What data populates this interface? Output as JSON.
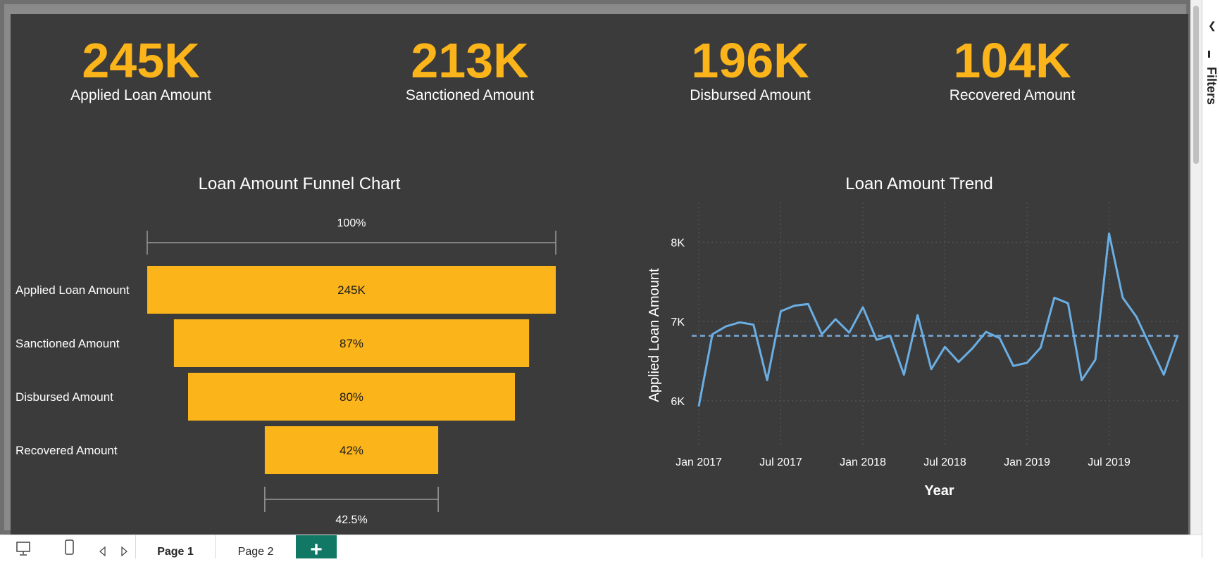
{
  "kpis": [
    {
      "value": "245K",
      "label": "Applied Loan Amount"
    },
    {
      "value": "213K",
      "label": "Sanctioned Amount"
    },
    {
      "value": "196K",
      "label": "Disbursed Amount"
    },
    {
      "value": "104K",
      "label": "Recovered Amount"
    }
  ],
  "colors": {
    "accent": "#fbb41a",
    "background": "#3b3b3b",
    "line": "#6aaee3",
    "add_tab": "#117865"
  },
  "funnel": {
    "title": "Loan Amount Funnel Chart",
    "top_label": "100%",
    "bottom_label": "42.5%"
  },
  "trend": {
    "title": "Loan Amount Trend"
  },
  "chart_data": [
    {
      "type": "bar",
      "subtype": "funnel",
      "title": "Loan Amount Funnel Chart",
      "categories": [
        "Applied Loan Amount",
        "Sanctioned Amount",
        "Disbursed Amount",
        "Recovered Amount"
      ],
      "values": [
        245,
        213,
        196,
        104
      ],
      "value_unit": "K",
      "bar_labels": [
        "245K",
        "87%",
        "80%",
        "42%"
      ],
      "top_annotation": "100%",
      "bottom_annotation": "42.5%"
    },
    {
      "type": "line",
      "title": "Loan Amount Trend",
      "xlabel": "Year",
      "ylabel": "Applied Loan Amount",
      "x_ticks": [
        "Jan 2017",
        "Jul 2017",
        "Jan 2018",
        "Jul 2018",
        "Jan 2019",
        "Jul 2019"
      ],
      "y_ticks": [
        "6K",
        "7K",
        "8K"
      ],
      "ylim": [
        5600,
        8500
      ],
      "grid": true,
      "reference_line": {
        "style": "dashed",
        "value": 6820
      },
      "series": [
        {
          "x": [
            "2017-01",
            "2017-02",
            "2017-03",
            "2017-04",
            "2017-05",
            "2017-06",
            "2017-07",
            "2017-08",
            "2017-09",
            "2017-10",
            "2017-11",
            "2017-12",
            "2018-01",
            "2018-02",
            "2018-03",
            "2018-04",
            "2018-05",
            "2018-06",
            "2018-07",
            "2018-08",
            "2018-09",
            "2018-10",
            "2018-11",
            "2018-12",
            "2019-01",
            "2019-02",
            "2019-03",
            "2019-04",
            "2019-05",
            "2019-06",
            "2019-07",
            "2019-08",
            "2019-09",
            "2019-10",
            "2019-11",
            "2019-12"
          ],
          "values": [
            5930,
            6840,
            6940,
            6990,
            6960,
            6260,
            7130,
            7200,
            7220,
            6840,
            7030,
            6860,
            7180,
            6770,
            6820,
            6330,
            7080,
            6400,
            6680,
            6490,
            6660,
            6870,
            6790,
            6440,
            6480,
            6670,
            7300,
            7230,
            6260,
            6520,
            8110,
            7300,
            7060,
            6690,
            6330,
            6820
          ]
        }
      ]
    }
  ],
  "side_pane": {
    "filters_label": "Filters"
  },
  "page_bar": {
    "tabs": [
      "Page 1",
      "Page 2"
    ],
    "add_label": "+"
  }
}
